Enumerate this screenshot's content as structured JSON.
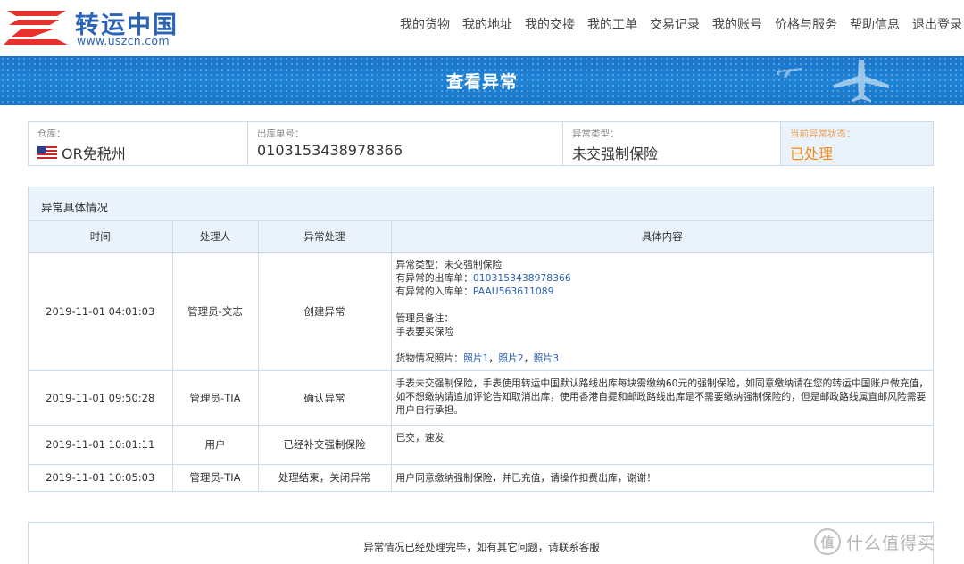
{
  "header": {
    "logo_name": "转运中国",
    "logo_url": "www.uszcn.com",
    "nav": [
      "我的货物",
      "我的地址",
      "我的交接",
      "我的工单",
      "交易记录",
      "我的账号",
      "价格与服务",
      "帮助信息",
      "退出登录"
    ]
  },
  "banner": {
    "title": "查看异常"
  },
  "info": {
    "warehouse_label": "仓库：",
    "warehouse_value": "OR免税州",
    "outbound_label": "出库单号：",
    "outbound_value": "0103153438978366",
    "type_label": "异常类型：",
    "type_value": "未交强制保险",
    "status_label": "当前异常状态：",
    "status_value": "已处理"
  },
  "panel": {
    "title": "异常具体情况",
    "columns": [
      "时间",
      "处理人",
      "异常处理",
      "具体内容"
    ],
    "rows": [
      {
        "time": "2019-11-01 04:01:03",
        "handler": "管理员-文志",
        "action": "创建异常",
        "line1": "异常类型：未交强制保险",
        "line2_label": "有异常的出库单：",
        "line2_value": "0103153438978366",
        "line3_label": "有异常的入库单：",
        "line3_value": "PAAU563611089",
        "line4": "管理员备注：",
        "line5": "手表要买保险",
        "photos_label": "货物情况照片：",
        "photo1": "照片1",
        "photo2": "照片2",
        "photo3": "照片3",
        "sep": "，"
      },
      {
        "time": "2019-11-01 09:50:28",
        "handler": "管理员-TIA",
        "action": "确认异常",
        "content": "手表未交强制保险，手表使用转运中国默认路线出库每块需缴纳60元的强制保险，如同意缴纳请在您的转运中国账户做充值，如不想缴纳请追加评论告知取消出库，使用香港自提和邮政路线出库是不需要缴纳强制保险的，但是邮政路线属直邮风险需要用户自行承担。"
      },
      {
        "time": "2019-11-01 10:01:11",
        "handler": "用户",
        "action": "已经补交强制保险",
        "content": "已交，速发"
      },
      {
        "time": "2019-11-01 10:05:03",
        "handler": "管理员-TIA",
        "action": "处理结束，关闭异常",
        "content": "用户同意缴纳强制保险，并已充值，请操作扣费出库，谢谢！"
      }
    ]
  },
  "notice": {
    "text": "异常情况已经处理完毕，如有其它问题，请联系客服"
  },
  "watermark": {
    "badge": "值",
    "text": "什么值得买"
  },
  "colors": {
    "brand_blue": "#2b63b6",
    "banner_blue": "#1e83d6",
    "status_orange": "#f08c16",
    "logo_red": "#e5322d"
  }
}
